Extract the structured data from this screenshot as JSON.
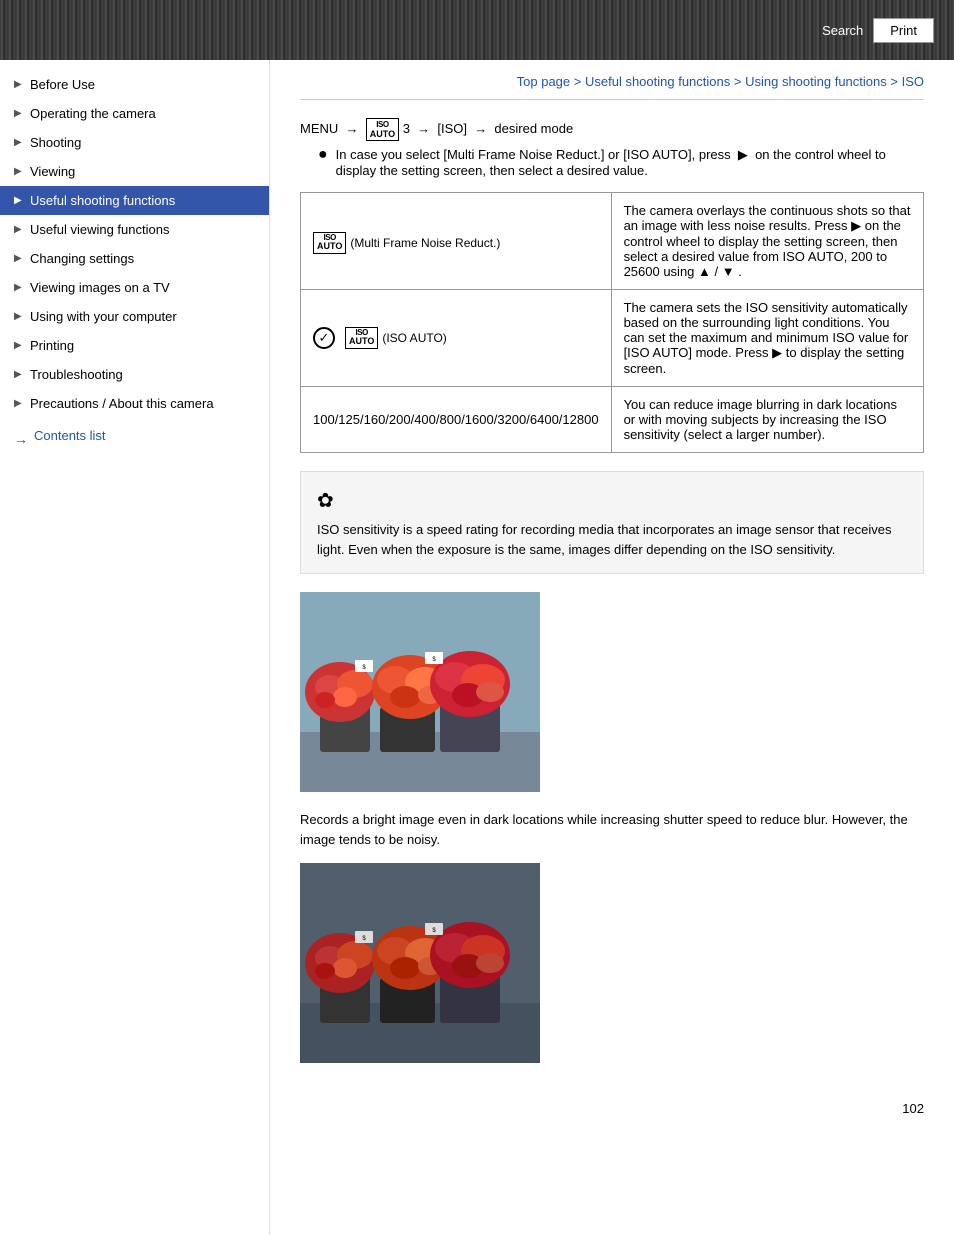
{
  "header": {
    "search_label": "Search",
    "print_label": "Print"
  },
  "breadcrumb": {
    "top_page": "Top page",
    "useful_shooting": "Useful shooting functions",
    "using_shooting": "Using shooting functions",
    "iso": "ISO",
    "separator": " > "
  },
  "menu_instruction": {
    "line1": "MENU → 📷 3 → [ISO] → desired mode",
    "bullet": "In case you select [Multi Frame Noise Reduct.] or [ISO AUTO], press  ▶  on the control wheel to display the setting screen, then select a desired value."
  },
  "table": {
    "rows": [
      {
        "left_icon": "ISO AUTO badge + Multi Frame Noise Reduct.",
        "left_text": "(Multi Frame Noise Reduct.)",
        "right_text": "The camera overlays the continuous shots so that an image with less noise results. Press ▶ on the control wheel to display the setting screen, then select a desired value from ISO AUTO, 200 to 25600 using  ▲ / ▼ ."
      },
      {
        "left_icon": "checkmark + ISO AUTO",
        "left_text": "(ISO AUTO)",
        "right_text": "The camera sets the ISO sensitivity automatically based on the surrounding light conditions. You can set the maximum and minimum ISO value for [ISO AUTO] mode. Press  ▶  to display the setting screen."
      },
      {
        "left_icon": "none",
        "left_text": "100/125/160/200/400/800/1600/3200/6400/12800",
        "right_text": "You can reduce image blurring in dark locations or with moving subjects by increasing the ISO sensitivity (select a larger number)."
      }
    ]
  },
  "tip": {
    "icon": "☆",
    "text": "ISO sensitivity is a speed rating for recording media that incorporates an image sensor that receives light. Even when the exposure is the same, images differ depending on the ISO sensitivity."
  },
  "photo_caption_1": "Records a bright image even in dark locations while increasing shutter speed to reduce blur. However, the image tends to be noisy.",
  "sidebar": {
    "items": [
      {
        "label": "Before Use",
        "active": false
      },
      {
        "label": "Operating the camera",
        "active": false
      },
      {
        "label": "Shooting",
        "active": false
      },
      {
        "label": "Viewing",
        "active": false
      },
      {
        "label": "Useful shooting functions",
        "active": true
      },
      {
        "label": "Useful viewing functions",
        "active": false
      },
      {
        "label": "Changing settings",
        "active": false
      },
      {
        "label": "Viewing images on a TV",
        "active": false
      },
      {
        "label": "Using with your computer",
        "active": false
      },
      {
        "label": "Printing",
        "active": false
      },
      {
        "label": "Troubleshooting",
        "active": false
      },
      {
        "label": "Precautions / About this camera",
        "active": false
      }
    ],
    "contents_link": "Contents list"
  },
  "page_number": "102"
}
